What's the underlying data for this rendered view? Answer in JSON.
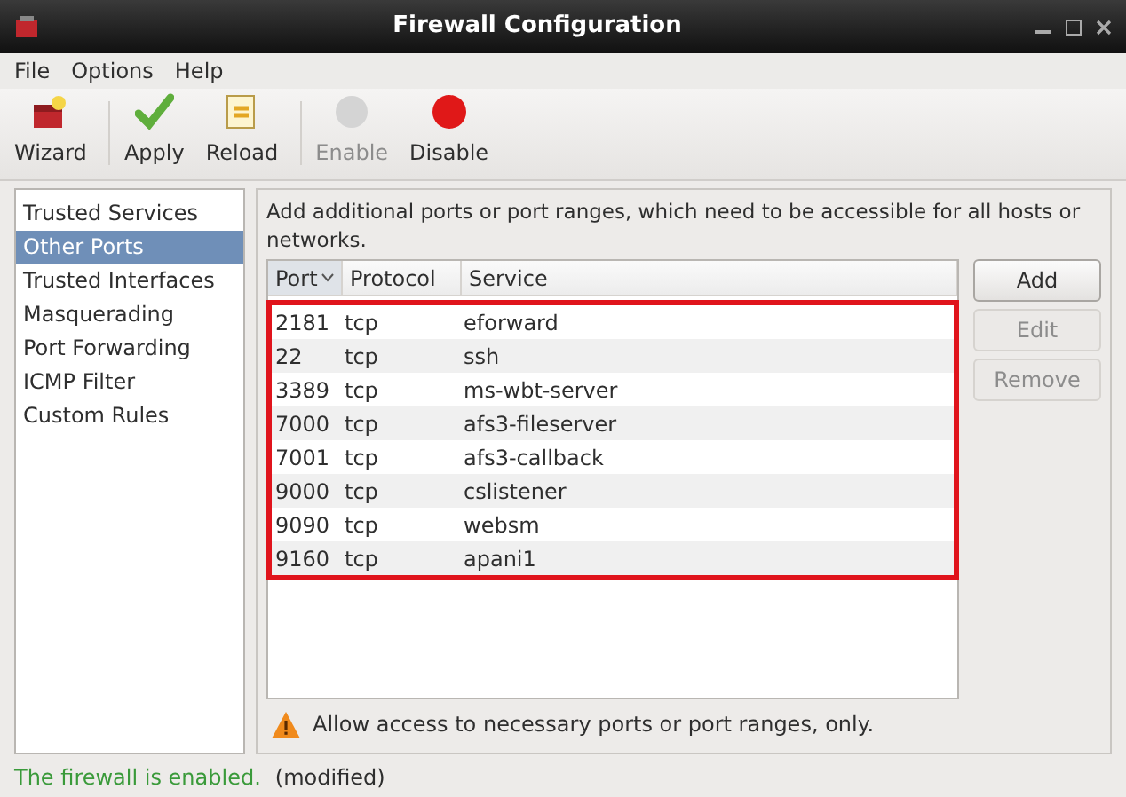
{
  "window": {
    "title": "Firewall Configuration"
  },
  "menu": [
    "File",
    "Options",
    "Help"
  ],
  "toolbar": [
    {
      "label": "Wizard",
      "kind": "wizard",
      "disabled": false
    },
    {
      "label": "Apply",
      "kind": "apply",
      "disabled": false
    },
    {
      "label": "Reload",
      "kind": "reload",
      "disabled": false
    },
    {
      "label": "Enable",
      "kind": "enable",
      "disabled": true
    },
    {
      "label": "Disable",
      "kind": "disable",
      "disabled": false
    }
  ],
  "sidebar": {
    "items": [
      {
        "label": "Trusted Services",
        "selected": false
      },
      {
        "label": "Other Ports",
        "selected": true
      },
      {
        "label": "Trusted Interfaces",
        "selected": false
      },
      {
        "label": "Masquerading",
        "selected": false
      },
      {
        "label": "Port Forwarding",
        "selected": false
      },
      {
        "label": "ICMP Filter",
        "selected": false
      },
      {
        "label": "Custom Rules",
        "selected": false
      }
    ]
  },
  "description": "Add additional ports or port ranges, which need to be accessible for all hosts or networks.",
  "table": {
    "columns": [
      {
        "label": "Port",
        "sorted": true
      },
      {
        "label": "Protocol",
        "sorted": false
      },
      {
        "label": "Service",
        "sorted": false
      }
    ],
    "rows": [
      [
        "2181",
        "tcp",
        "eforward"
      ],
      [
        "22",
        "tcp",
        "ssh"
      ],
      [
        "3389",
        "tcp",
        "ms-wbt-server"
      ],
      [
        "7000",
        "tcp",
        "afs3-fileserver"
      ],
      [
        "7001",
        "tcp",
        "afs3-callback"
      ],
      [
        "9000",
        "tcp",
        "cslistener"
      ],
      [
        "9090",
        "tcp",
        "websm"
      ],
      [
        "9160",
        "tcp",
        "apani1"
      ]
    ]
  },
  "buttons": [
    {
      "label": "Add",
      "disabled": false
    },
    {
      "label": "Edit",
      "disabled": true
    },
    {
      "label": "Remove",
      "disabled": true
    }
  ],
  "warning": "Allow access to necessary ports or port ranges, only.",
  "status_bar": {
    "state": "The firewall is enabled.",
    "note": "(modified)"
  }
}
